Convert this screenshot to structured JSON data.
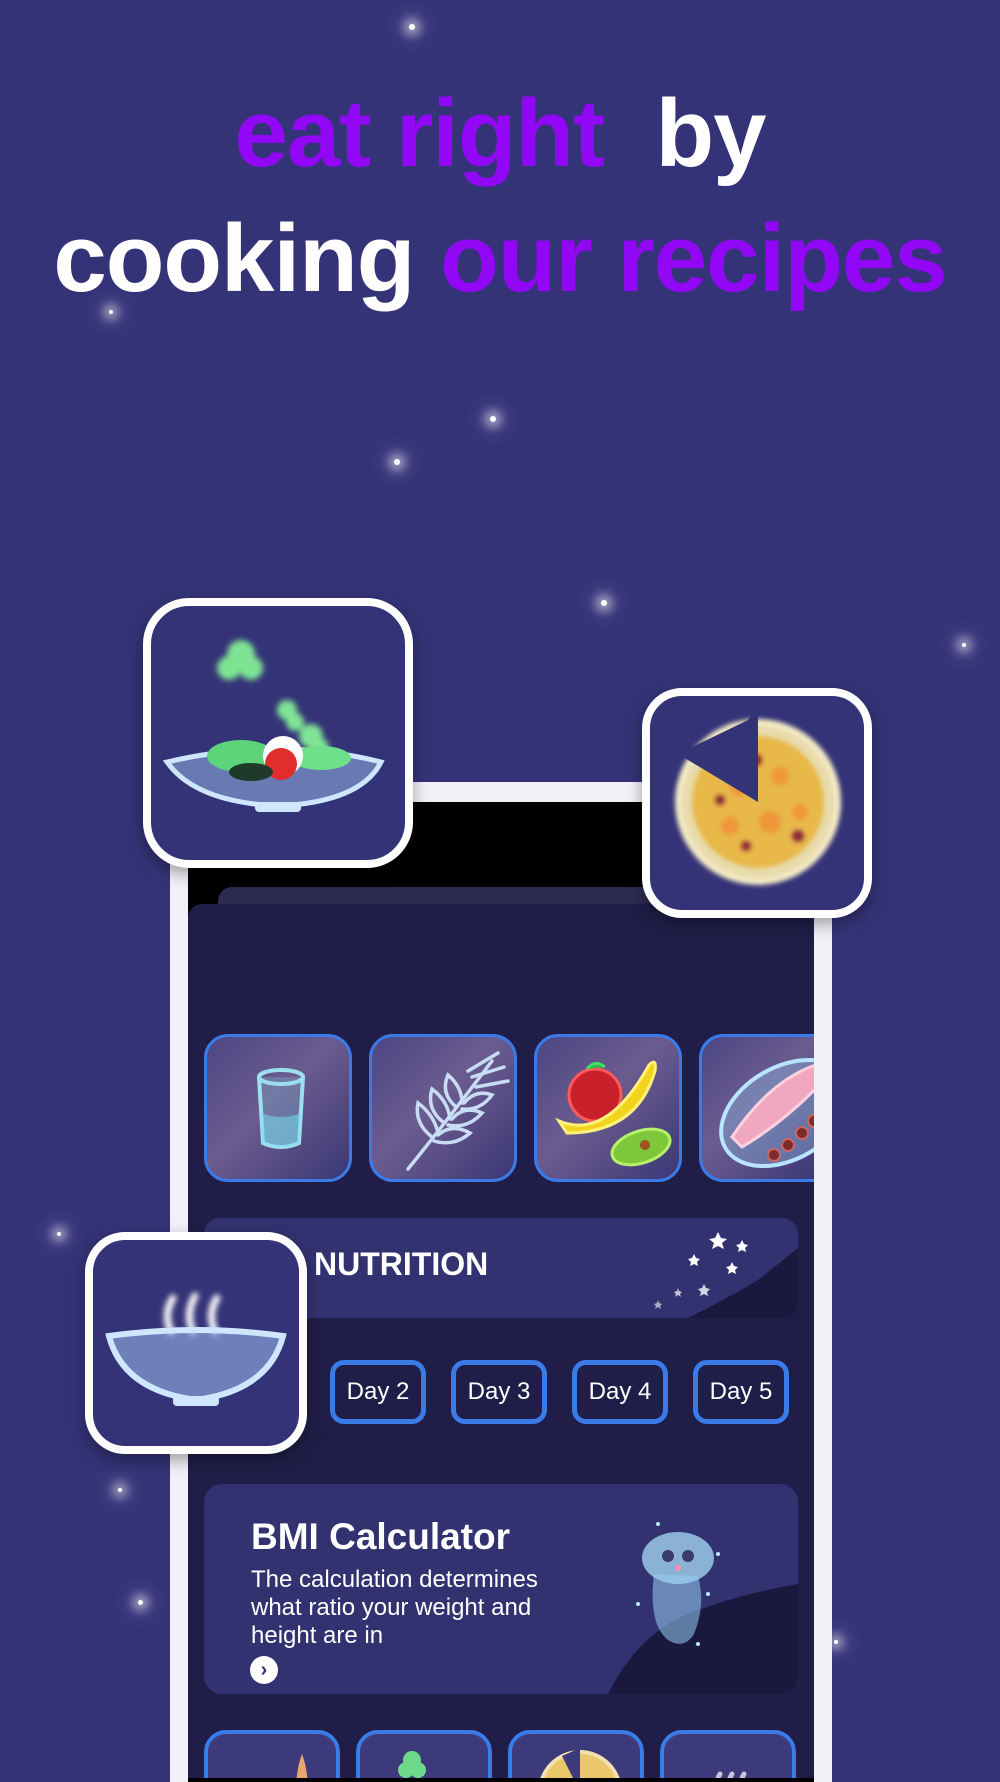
{
  "headline": {
    "line1_accent": "eat right",
    "line1_plain": "by",
    "line2_plain": "cooking",
    "line2_accent": "our recipes"
  },
  "colors": {
    "background": "#343377",
    "accent": "#9307f7",
    "tile_border": "#3a7be8",
    "screen_bg": "#201e48",
    "card_bg": "#333271"
  },
  "food_categories": [
    {
      "icon": "water-glass-icon"
    },
    {
      "icon": "wheat-icon"
    },
    {
      "icon": "fruits-icon"
    },
    {
      "icon": "fish-icon"
    }
  ],
  "nutrition": {
    "title": "NUTRITION"
  },
  "days": [
    "Day 2",
    "Day 3",
    "Day 4",
    "Day 5"
  ],
  "bmi": {
    "title": "BMI Calculator",
    "description": "The calculation determines what ratio your weight and height are in",
    "arrow": "›"
  },
  "floating_icons": [
    "salad-bowl-icon",
    "pizza-icon",
    "soup-bowl-icon"
  ]
}
